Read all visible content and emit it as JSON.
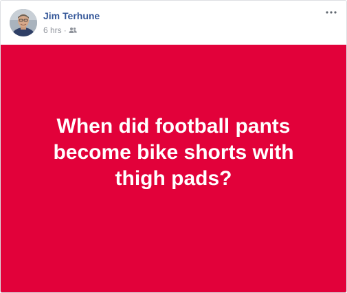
{
  "post": {
    "author": "Jim Terhune",
    "time": "6 hrs",
    "separator": "·",
    "audience_icon": "friends-icon",
    "more_icon": "more-options-icon",
    "status_text": "When did football pants become bike shorts with thigh pads?",
    "background_color": "#e2013a",
    "text_color": "#ffffff",
    "author_color": "#365899"
  }
}
